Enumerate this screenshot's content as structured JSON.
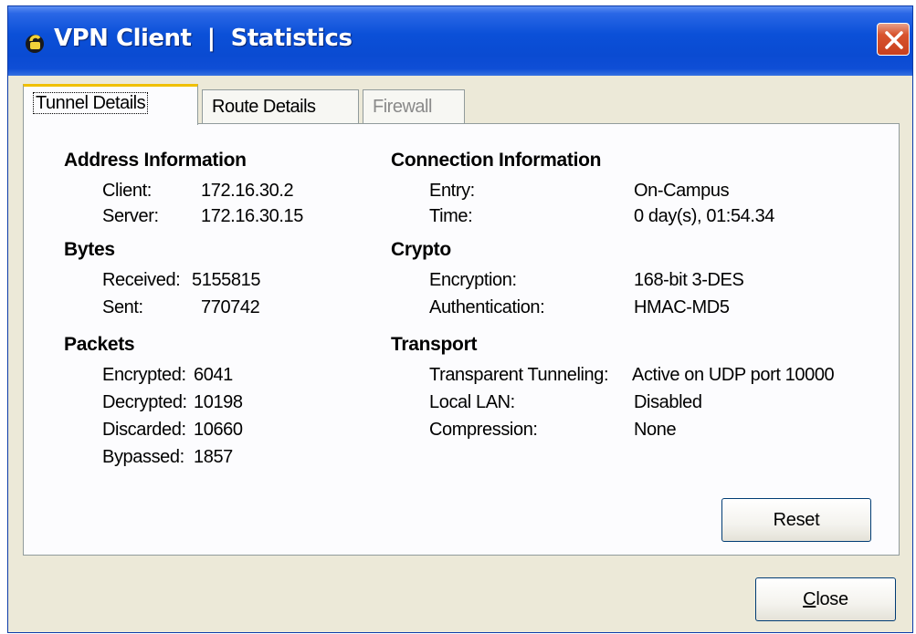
{
  "window": {
    "title": "VPN Client  |  Statistics"
  },
  "tabs": [
    {
      "label": "Tunnel Details",
      "active": true
    },
    {
      "label": "Route Details",
      "active": false
    },
    {
      "label": "Firewall",
      "active": false,
      "disabled": true
    }
  ],
  "address": {
    "heading": "Address Information",
    "rows": [
      {
        "label": "Client:",
        "value": "172.16.30.2"
      },
      {
        "label": "Server:",
        "value": "172.16.30.15"
      }
    ]
  },
  "bytes": {
    "heading": "Bytes",
    "rows": [
      {
        "label": "Received:",
        "value": "5155815"
      },
      {
        "label": "Sent:",
        "value": "770742"
      }
    ]
  },
  "packets": {
    "heading": "Packets",
    "rows": [
      {
        "label": "Encrypted:",
        "value": "6041"
      },
      {
        "label": "Decrypted:",
        "value": "10198"
      },
      {
        "label": "Discarded:",
        "value": "10660"
      },
      {
        "label": "Bypassed:",
        "value": "1857"
      }
    ]
  },
  "connection": {
    "heading": "Connection Information",
    "rows": [
      {
        "label": "Entry:",
        "value": "On-Campus"
      },
      {
        "label": "Time:",
        "value": "0 day(s), 01:54.34"
      }
    ]
  },
  "crypto": {
    "heading": "Crypto",
    "rows": [
      {
        "label": "Encryption:",
        "value": "168-bit 3-DES"
      },
      {
        "label": "Authentication:",
        "value": "HMAC-MD5"
      }
    ]
  },
  "transport": {
    "heading": "Transport",
    "rows": [
      {
        "label": "Transparent Tunneling:",
        "value": "Active on UDP port 10000"
      },
      {
        "label": "Local LAN:",
        "value": "Disabled"
      },
      {
        "label": "Compression:",
        "value": "None"
      }
    ]
  },
  "buttons": {
    "reset": "Reset",
    "close_mnemonic": "C",
    "close_rest": "lose"
  }
}
